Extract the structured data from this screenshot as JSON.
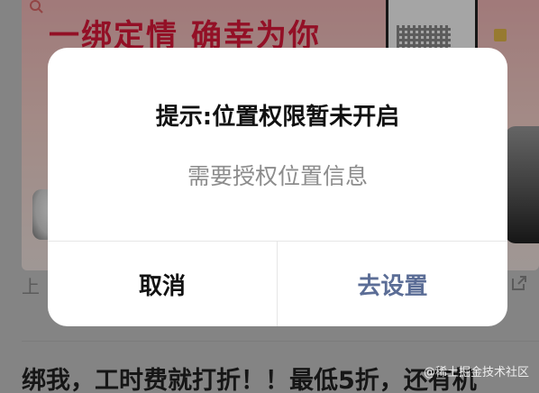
{
  "background": {
    "banner_headline": "一绑定情 确幸为你",
    "card_text": "上",
    "title_text": "绑我，工时费就打折！！最低5折，还有机",
    "watermark": "@稀土掘金技术社区"
  },
  "dialog": {
    "title": "提示:位置权限暂未开启",
    "message": "需要授权位置信息",
    "cancel_label": "取消",
    "settings_label": "去设置"
  },
  "colors": {
    "accent": "#5b6d96",
    "headline_red": "#e0193a"
  },
  "icons": {
    "search": "search-icon",
    "external_link": "external-link-icon"
  }
}
